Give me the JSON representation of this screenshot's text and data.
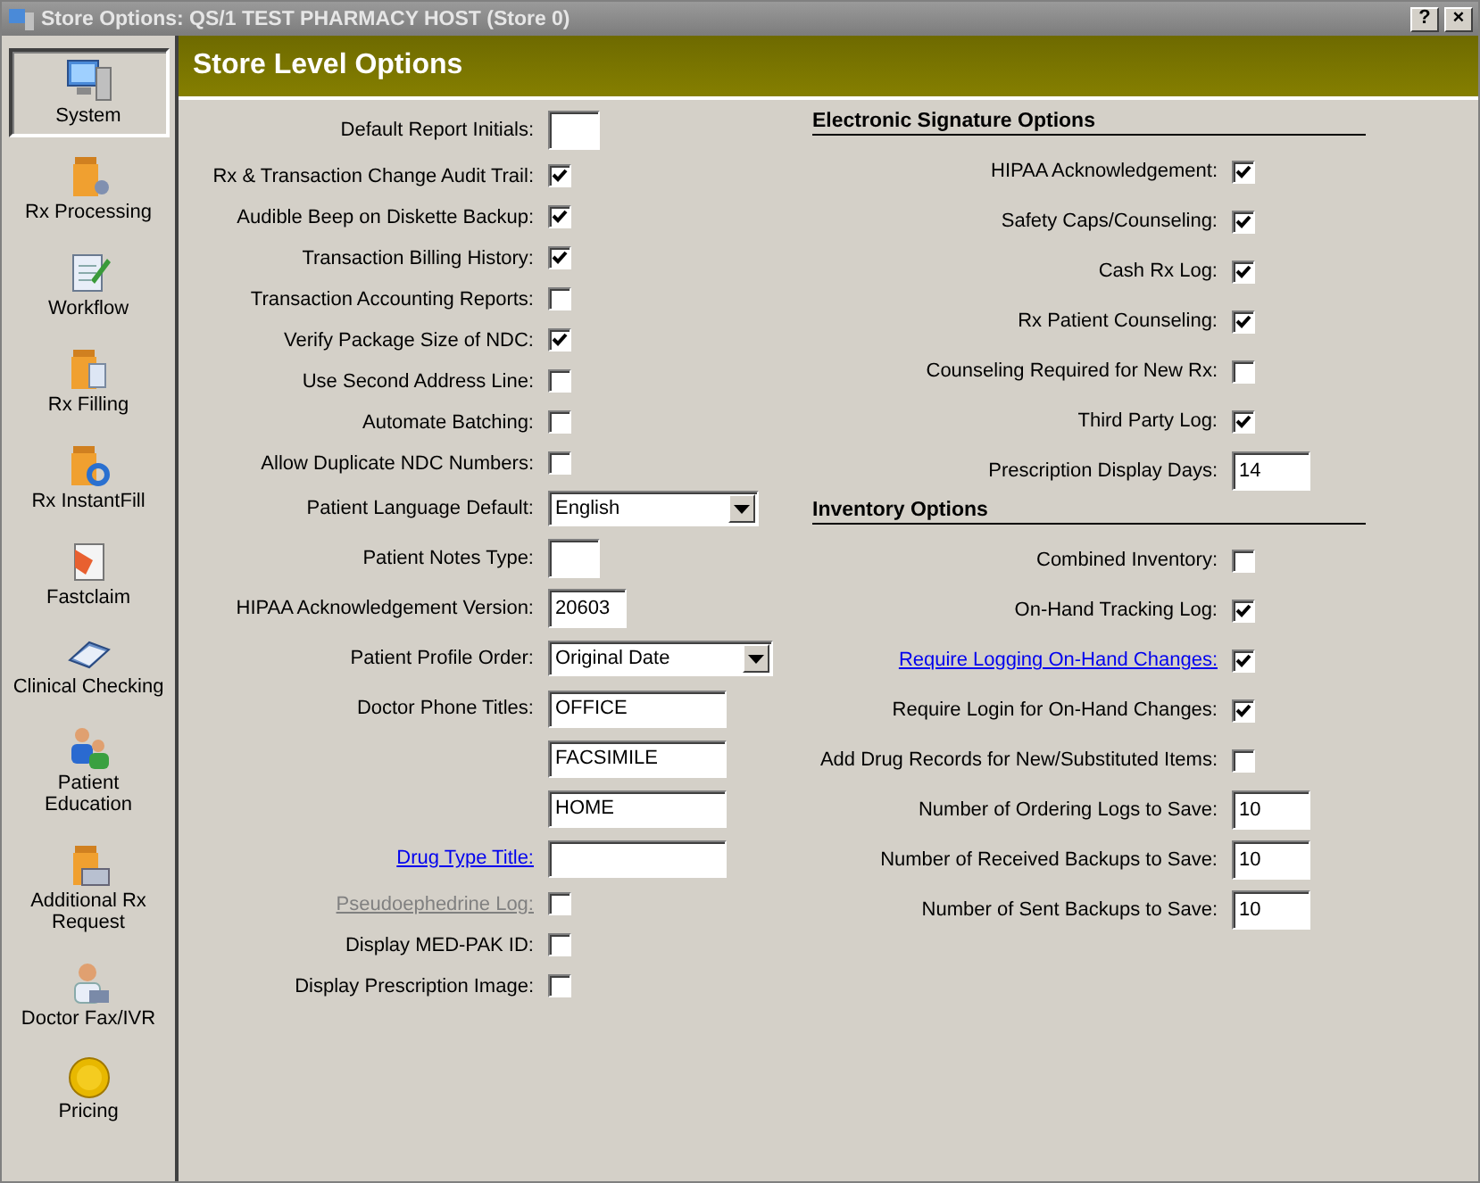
{
  "window": {
    "title": "Store Options: QS/1 TEST PHARMACY HOST (Store 0)",
    "buttons": [
      "?",
      "×"
    ]
  },
  "sidebar": {
    "items": [
      {
        "label": "System",
        "selected": true
      },
      {
        "label": "Rx Processing",
        "selected": false
      },
      {
        "label": "Workflow",
        "selected": false
      },
      {
        "label": "Rx Filling",
        "selected": false
      },
      {
        "label": "Rx InstantFill",
        "selected": false
      },
      {
        "label": "Fastclaim",
        "selected": false
      },
      {
        "label": "Clinical Checking",
        "selected": false
      },
      {
        "label": "Patient Education",
        "selected": false
      },
      {
        "label": "Additional Rx Request",
        "selected": false
      },
      {
        "label": "Doctor Fax/IVR",
        "selected": false
      },
      {
        "label": "Pricing",
        "selected": false
      }
    ]
  },
  "header": {
    "title": "Store Level Options"
  },
  "left_options": [
    {
      "label": "Default Report Initials:",
      "link": false,
      "disabled": false,
      "kind": "short-field"
    },
    {
      "label": "Rx & Transaction Change Audit Trail:",
      "link": false,
      "disabled": false,
      "kind": "checkbox",
      "checked": true
    },
    {
      "label": "Audible Beep on Diskette Backup:",
      "link": false,
      "disabled": false,
      "kind": "checkbox",
      "checked": true
    },
    {
      "label": "Transaction Billing History:",
      "link": false,
      "disabled": false,
      "kind": "checkbox",
      "checked": true
    },
    {
      "label": "Transaction Accounting Reports:",
      "link": false,
      "disabled": false,
      "kind": "checkbox",
      "checked": false
    },
    {
      "label": "Verify Package Size of NDC:",
      "link": false,
      "disabled": false,
      "kind": "checkbox",
      "checked": true
    },
    {
      "label": "Use Second Address Line:",
      "link": false,
      "disabled": false,
      "kind": "checkbox",
      "checked": false
    },
    {
      "label": "Automate Batching:",
      "link": false,
      "disabled": false,
      "kind": "checkbox",
      "checked": false
    },
    {
      "label": "Allow Duplicate NDC Numbers:",
      "link": false,
      "disabled": false,
      "kind": "checkbox",
      "checked": false
    },
    {
      "label": "Patient Language Default:",
      "link": false,
      "disabled": false,
      "kind": "select",
      "value": "English"
    },
    {
      "label": "Patient Notes Type:",
      "link": false,
      "disabled": false,
      "kind": "short-field"
    },
    {
      "label": "HIPAA Acknowledgement Version:",
      "link": false,
      "disabled": false,
      "kind": "number-field",
      "value": "20603"
    },
    {
      "label": "Patient Profile Order:",
      "link": false,
      "disabled": false,
      "kind": "wide-select",
      "value": "Original Date"
    },
    {
      "label": "Doctor Phone Titles:",
      "link": false,
      "disabled": false,
      "kind": "text-field",
      "value": "OFFICE"
    },
    {
      "kind": "text-field",
      "value": "FACSIMILE"
    },
    {
      "kind": "text-field",
      "value": "HOME"
    },
    {
      "label": "Drug Type Title:",
      "link": true,
      "disabled": false,
      "kind": "text-field"
    },
    {
      "label": "Pseudoephedrine Log:",
      "link": true,
      "disabled": true,
      "kind": "checkbox",
      "checked": false
    },
    {
      "label": "Display MED-PAK ID:",
      "link": false,
      "disabled": false,
      "kind": "checkbox",
      "checked": false
    },
    {
      "label": "Display Prescription Image:",
      "link": false,
      "disabled": false,
      "kind": "checkbox",
      "checked": false
    }
  ],
  "sections": [
    {
      "title": "Electronic Signature Options",
      "options": [
        {
          "label": "HIPAA Acknowledgement:",
          "link": false,
          "disabled": false,
          "kind": "checkbox",
          "checked": true
        },
        {
          "label": "Safety Caps/Counseling:",
          "link": false,
          "disabled": false,
          "kind": "checkbox",
          "checked": true
        },
        {
          "label": "Cash Rx Log:",
          "link": false,
          "disabled": false,
          "kind": "checkbox",
          "checked": true
        },
        {
          "label": "Rx Patient Counseling:",
          "link": false,
          "disabled": false,
          "kind": "checkbox",
          "checked": true
        },
        {
          "label": "Counseling Required for New Rx:",
          "link": false,
          "disabled": false,
          "kind": "checkbox",
          "checked": false
        },
        {
          "label": "Third Party Log:",
          "link": false,
          "disabled": false,
          "kind": "checkbox",
          "checked": true
        },
        {
          "label": "Prescription Display Days:",
          "link": false,
          "disabled": false,
          "kind": "number-field",
          "value": "14"
        }
      ]
    },
    {
      "title": "Inventory Options",
      "options": [
        {
          "label": "Combined Inventory:",
          "link": false,
          "disabled": false,
          "kind": "checkbox",
          "checked": false
        },
        {
          "label": "On-Hand Tracking Log:",
          "link": false,
          "disabled": false,
          "kind": "checkbox",
          "checked": true
        },
        {
          "label": "Require Logging On-Hand Changes:",
          "link": true,
          "disabled": false,
          "kind": "checkbox",
          "checked": true
        },
        {
          "label": "Require Login for On-Hand Changes:",
          "link": false,
          "disabled": false,
          "kind": "checkbox",
          "checked": true
        },
        {
          "label": "Add Drug Records for New/Substituted Items:",
          "link": false,
          "disabled": false,
          "kind": "checkbox",
          "checked": false
        },
        {
          "label": "Number of Ordering Logs to Save:",
          "link": false,
          "disabled": false,
          "kind": "number-field",
          "value": "10"
        },
        {
          "label": "Number of Received Backups to Save:",
          "link": false,
          "disabled": false,
          "kind": "number-field",
          "value": "10"
        },
        {
          "label": "Number of Sent Backups to Save:",
          "link": false,
          "disabled": false,
          "kind": "number-field",
          "value": "10"
        }
      ]
    }
  ]
}
